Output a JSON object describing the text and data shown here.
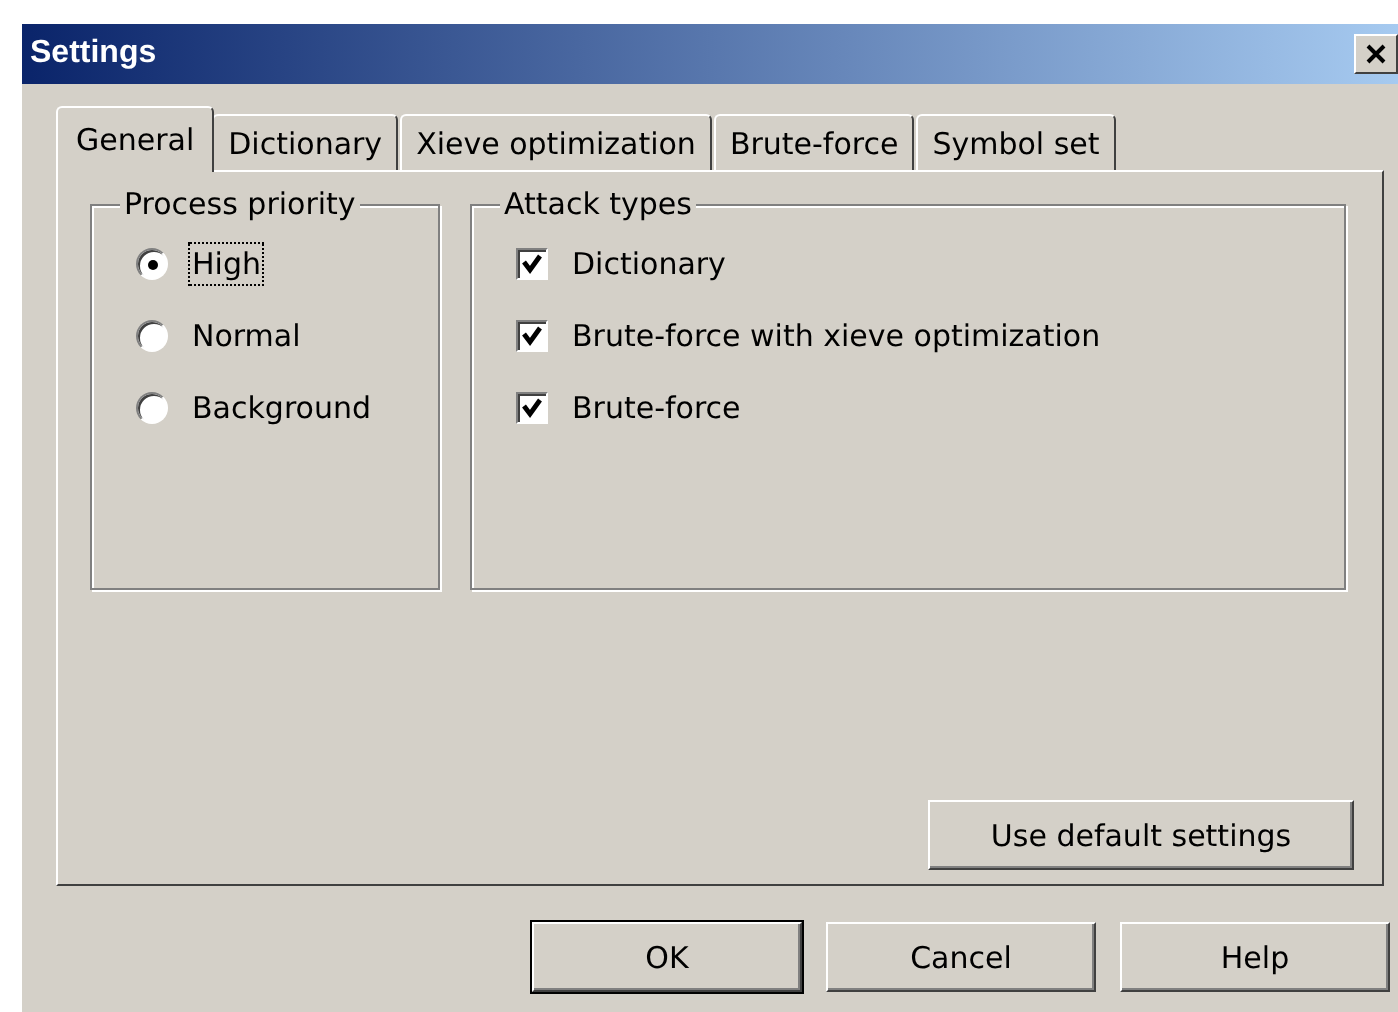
{
  "window": {
    "title": "Settings"
  },
  "tabs": [
    {
      "label": "General",
      "selected": true
    },
    {
      "label": "Dictionary",
      "selected": false
    },
    {
      "label": "Xieve optimization",
      "selected": false
    },
    {
      "label": "Brute-force",
      "selected": false
    },
    {
      "label": "Symbol set",
      "selected": false
    }
  ],
  "process_priority": {
    "title": "Process priority",
    "options": [
      {
        "label": "High",
        "selected": true,
        "focused": true
      },
      {
        "label": "Normal",
        "selected": false,
        "focused": false
      },
      {
        "label": "Background",
        "selected": false,
        "focused": false
      }
    ]
  },
  "attack_types": {
    "title": "Attack types",
    "options": [
      {
        "label": "Dictionary",
        "checked": true
      },
      {
        "label": "Brute-force with xieve optimization",
        "checked": true
      },
      {
        "label": "Brute-force",
        "checked": true
      }
    ]
  },
  "defaults_button": {
    "label": "Use default settings"
  },
  "buttons": [
    {
      "label": "OK",
      "default": true
    },
    {
      "label": "Cancel",
      "default": false
    },
    {
      "label": "Help",
      "default": false
    }
  ]
}
